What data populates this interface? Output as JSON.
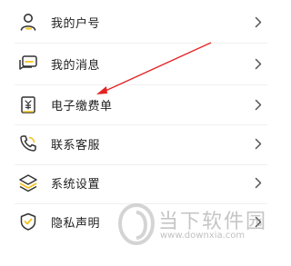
{
  "menu": {
    "items": [
      {
        "label": "我的户号",
        "icon": "user-icon"
      },
      {
        "label": "我的消息",
        "icon": "message-icon"
      },
      {
        "label": "电子缴费单",
        "icon": "bill-icon"
      },
      {
        "label": "联系客服",
        "icon": "phone-icon"
      },
      {
        "label": "系统设置",
        "icon": "layers-icon"
      },
      {
        "label": "隐私声明",
        "icon": "shield-icon"
      }
    ]
  },
  "annotation": {
    "color": "#e52222"
  },
  "colors": {
    "accent": "#f5c21b",
    "icon_stroke": "#333333",
    "chevron": "#555555"
  },
  "watermark": {
    "title": "当下软件园",
    "url": "www.downxia.com"
  }
}
